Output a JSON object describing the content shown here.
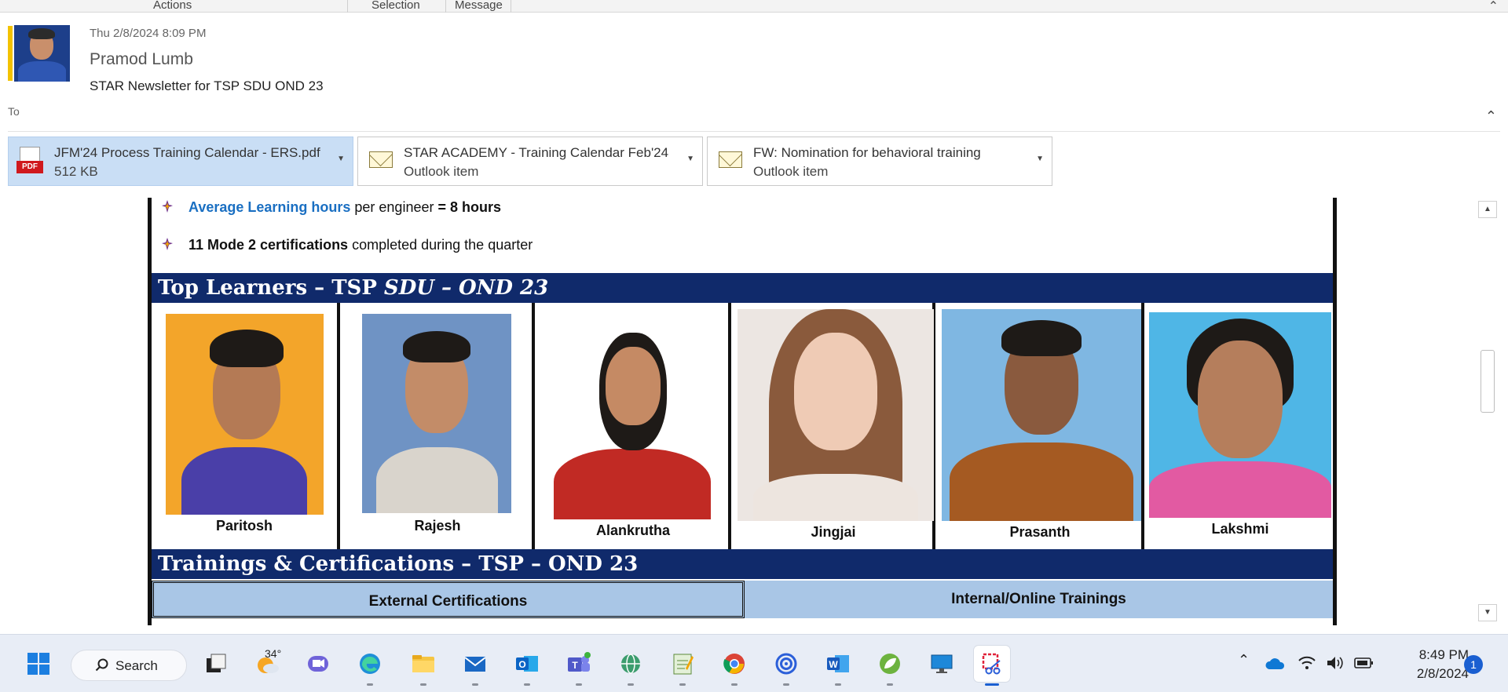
{
  "ribbon": {
    "groups": [
      "Actions",
      "Selection",
      "Message"
    ]
  },
  "message": {
    "date": "Thu 2/8/2024 8:09 PM",
    "sender": "Pramod Lumb",
    "subject": "STAR Newsletter for TSP SDU OND 23",
    "to_label": "To"
  },
  "attachments": [
    {
      "name": "JFM'24 Process Training Calendar - ERS.pdf",
      "sub": "512 KB",
      "icon": "pdf-icon",
      "pdf_tag": "PDF"
    },
    {
      "name": "STAR ACADEMY -  Training Calendar Feb'24",
      "sub": "Outlook item",
      "icon": "envelope-icon"
    },
    {
      "name": "FW: Nomination for behavioral training",
      "sub": "Outlook item",
      "icon": "envelope-icon"
    }
  ],
  "body": {
    "bullet1": {
      "highlight": "Average Learning hours",
      "rest": " per engineer ",
      "value": "= 8 hours"
    },
    "bullet2": {
      "bold": "11 Mode 2 certifications",
      "rest": " completed during the quarter"
    },
    "learners_band": {
      "prefix": "Top Learners – TSP ",
      "italic": "SDU – OND 23"
    },
    "learners": [
      "Paritosh",
      "Rajesh",
      "Alankrutha",
      "Jingjai",
      "Prasanth",
      "Lakshmi"
    ],
    "trainings_band": "Trainings & Certifications – TSP – OND 23",
    "table_headers": [
      "External Certifications",
      "Internal/Online Trainings"
    ]
  },
  "taskbar": {
    "search_label": "Search",
    "weather_temp": "34°",
    "icons": [
      "windows-start-icon",
      "task-view-icon",
      "weather-icon",
      "teams-chat-icon",
      "edge-icon",
      "file-explorer-icon",
      "mail-icon",
      "outlook-icon",
      "teams-icon",
      "network-globe-icon",
      "notepad-icon",
      "chrome-icon",
      "spiral-app-icon",
      "word-icon",
      "spring-leaf-icon",
      "remote-desktop-icon",
      "snipping-tool-icon"
    ],
    "time": "8:49 PM",
    "date": "2/8/2024",
    "notification_count": "1"
  },
  "colors": {
    "band": "#102a6b",
    "table_header": "#a9c6e6",
    "accent": "#1a5fd1",
    "link_blue": "#1a6fc2",
    "attachment_selected": "#c9def5"
  }
}
